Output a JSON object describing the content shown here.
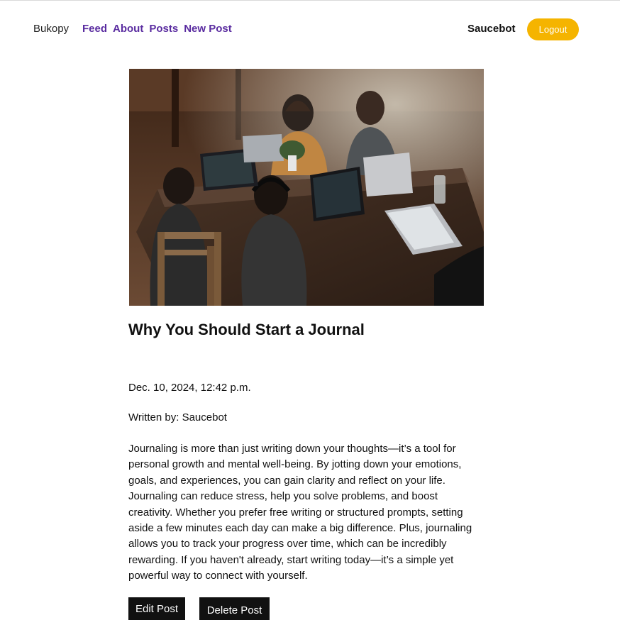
{
  "nav": {
    "brand": "Bukopy",
    "links": [
      "Feed",
      "About",
      "Posts",
      "New Post"
    ],
    "username": "Saucebot",
    "logout_label": "Logout"
  },
  "post": {
    "image_alt": "People working on laptops around a wooden table",
    "title": "Why You Should Start a Journal",
    "date": "Dec. 10, 2024, 12:42 p.m.",
    "author_line": "Written by: Saucebot",
    "body": "Journaling is more than just writing down your thoughts—it’s a tool for personal growth and mental well-being. By jotting down your emotions, goals, and experiences, you can gain clarity and reflect on your life. Journaling can reduce stress, help you solve problems, and boost creativity. Whether you prefer free writing or structured prompts, setting aside a few minutes each day can make a big difference. Plus, journaling allows you to track your progress over time, which can be incredibly rewarding. If you haven't already, start writing today—it’s a simple yet powerful way to connect with yourself."
  },
  "actions": {
    "edit_label": "Edit Post",
    "delete_label": "Delete Post"
  },
  "colors": {
    "nav_link": "#5a2ca0",
    "logout_bg": "#f5b400",
    "button_bg": "#111111"
  }
}
